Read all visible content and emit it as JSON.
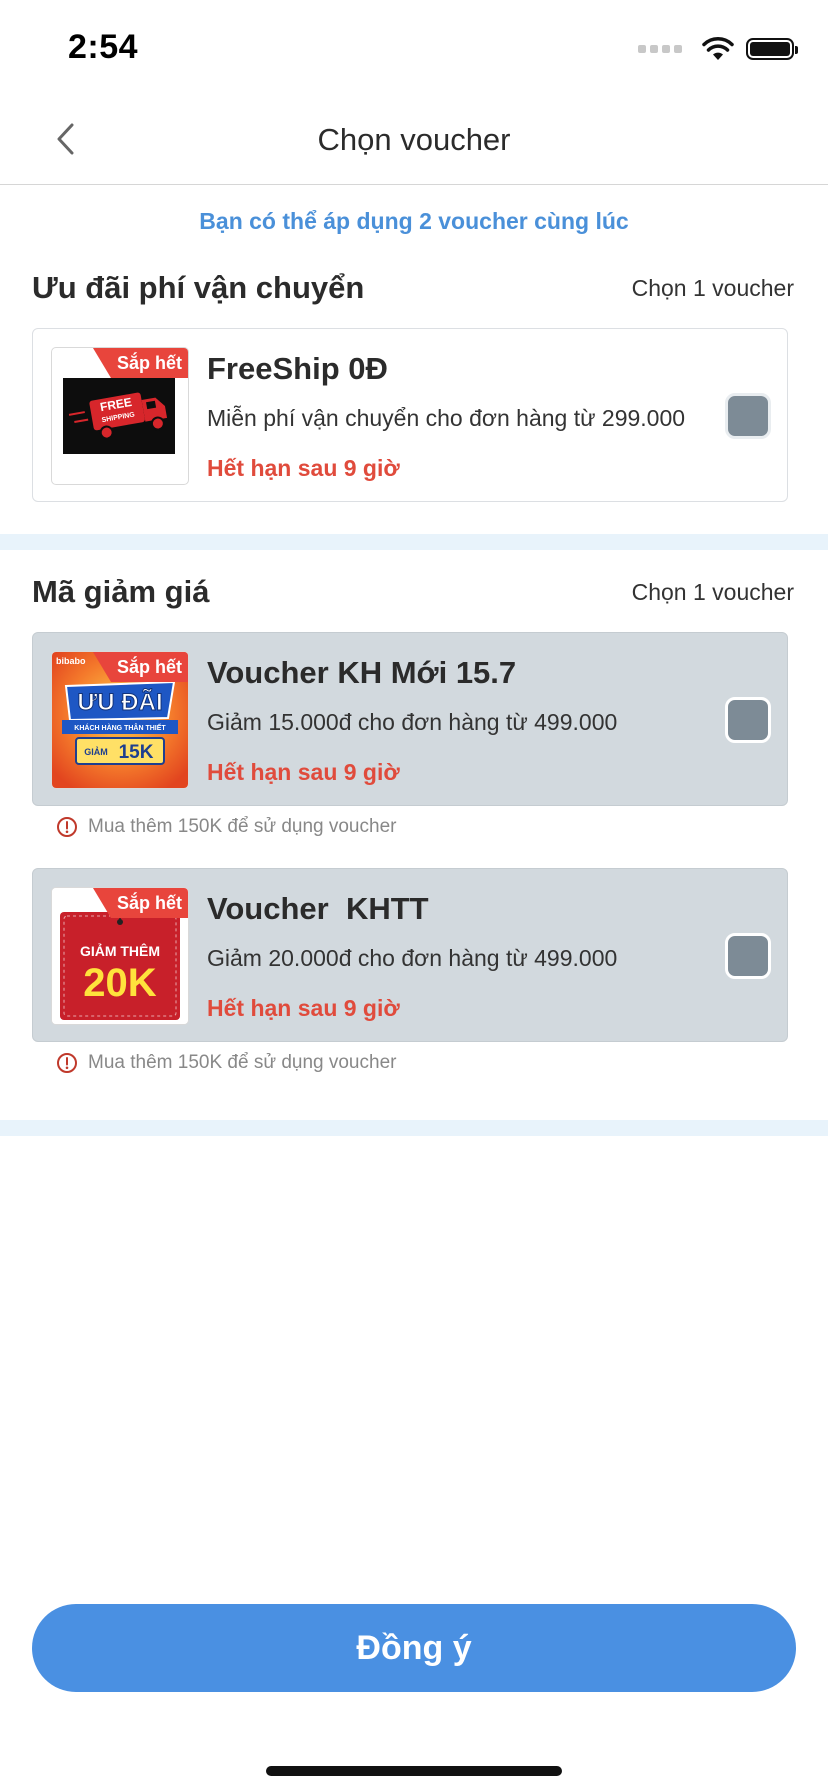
{
  "status_bar": {
    "time": "2:54"
  },
  "nav": {
    "title": "Chọn voucher"
  },
  "info": {
    "text": "Bạn có thể áp dụng 2 voucher cùng lúc"
  },
  "shipping_section": {
    "title": "Ưu đãi phí vận chuyển",
    "hint": "Chọn 1 voucher",
    "vouchers": [
      {
        "badge": "Sắp hết",
        "title": "FreeShip 0Đ",
        "description": "Miễn phí vận chuyển cho đơn hàng từ 299.000",
        "expiry": "Hết hạn sau 9 giờ",
        "thumb": {
          "line1": "FREE",
          "line2": "SHIPPING"
        },
        "checked": false
      }
    ]
  },
  "discount_section": {
    "title": "Mã giảm giá",
    "hint": "Chọn 1 voucher",
    "vouchers": [
      {
        "badge": "Sắp hết",
        "title": "Voucher KH Mới 15.7",
        "description": "Giảm 15.000đ cho đơn hàng từ 499.000",
        "expiry": "Hết hạn sau 9 giờ",
        "warning": "Mua thêm 150K để sử dụng voucher",
        "thumb": {
          "brand": "bibabo",
          "main": "ƯU ĐÃI",
          "sub": "KHÁCH HÀNG THÂN THIẾT",
          "tag": "GIẢM",
          "amount": "15K"
        },
        "disabled": true,
        "checked": false
      },
      {
        "badge": "Sắp hết",
        "title": "Voucher  KHTT",
        "description": "Giảm 20.000đ cho đơn hàng từ 499.000",
        "expiry": "Hết hạn sau 9 giờ",
        "warning": "Mua thêm 150K để sử dụng voucher",
        "thumb": {
          "top": "GIẢM THÊM",
          "amount": "20K"
        },
        "disabled": true,
        "checked": false
      }
    ]
  },
  "footer": {
    "confirm_label": "Đồng ý"
  },
  "colors": {
    "accent": "#4a90e2",
    "expiry": "#e04b3c",
    "badge": "#e8453c",
    "separator": "#e8f3fb",
    "disabled_card": "#d2d9de"
  }
}
